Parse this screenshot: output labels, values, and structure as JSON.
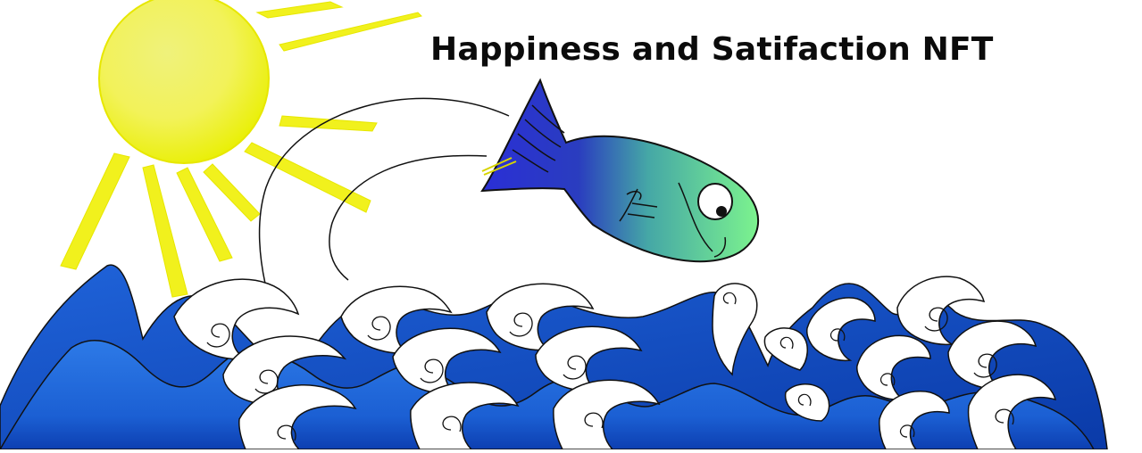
{
  "title": "Happiness and Satifaction NFT",
  "colors": {
    "sun": "#f3f32a",
    "sun_outline": "#e8e800",
    "water_deep": "#0f3fb3",
    "water_mid": "#1a5fd6",
    "water_light": "#2a78e6",
    "foam": "#ffffff",
    "fish_head": "#78ef98",
    "fish_tail": "#2e3cc9",
    "outline": "#111111"
  },
  "icons": {
    "sun": "sun-icon",
    "fish": "fish-icon",
    "waves": "waves-icon"
  }
}
